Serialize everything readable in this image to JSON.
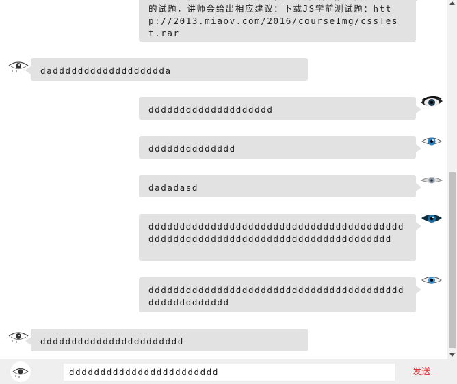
{
  "messages": [
    {
      "side": "right",
      "text": "这是一个很长的系统提示消息，用于测试，请在下方提交你的试题，讲师会给出相应建议：下载JS学前测试题：http://2013.miaov.com/2016/courseImg/cssTest.rar"
    },
    {
      "side": "left",
      "text": "dadddddddddddddddddda"
    },
    {
      "side": "right",
      "text": "dddddddddddddddddddd"
    },
    {
      "side": "right",
      "text": "dddddddddddddd"
    },
    {
      "side": "right",
      "text": "dadadasd"
    },
    {
      "side": "right",
      "text": "dddddddddddddddddddddddddddddddddddddddddddddddddddddddddddddddddddddddddddddddd"
    },
    {
      "side": "right",
      "text": "dddddddddddddddddddddddddddddddddddddddddddddddddddddd"
    },
    {
      "side": "left",
      "text": "ddddddddddddddddddddddd"
    }
  ],
  "composer": {
    "input_value": "dddddddddddddddddddddddd",
    "send_label": "发送"
  },
  "icons": {
    "avatar": "eye-avatar-icon",
    "scroll_up": "scroll-up-arrow-icon",
    "scroll_down": "scroll-down-arrow-icon"
  },
  "colors": {
    "bubble": "#e2e2e2",
    "send": "#e03a3a",
    "footer": "#efefef"
  }
}
